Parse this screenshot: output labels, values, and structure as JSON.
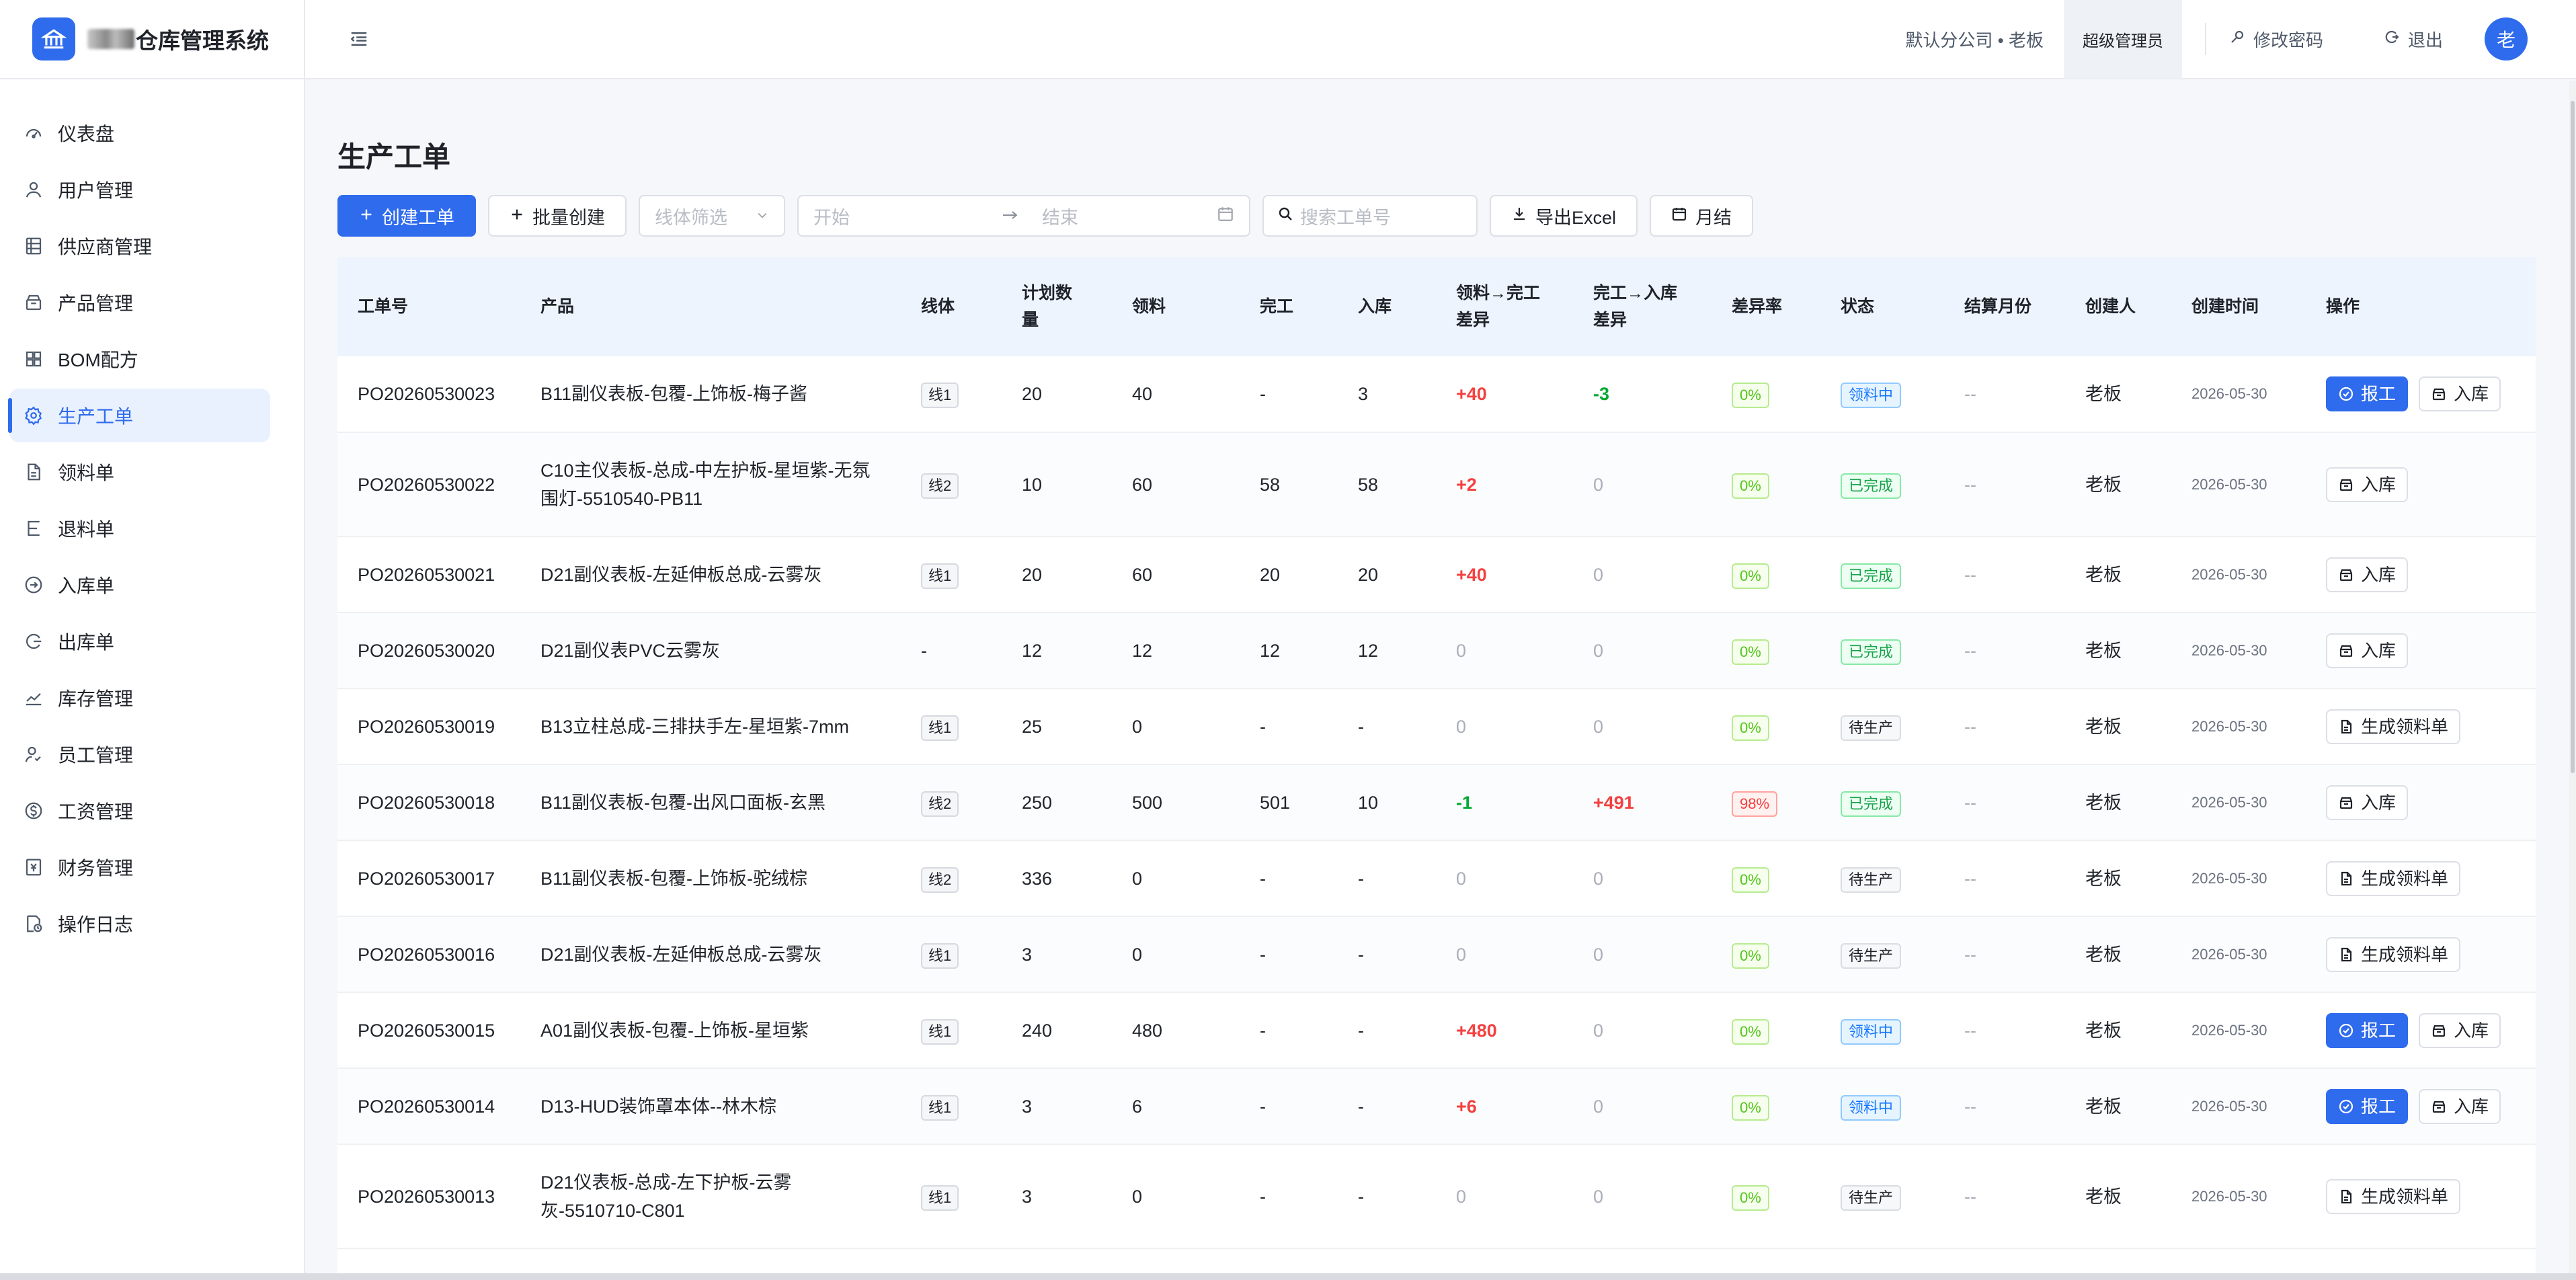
{
  "header": {
    "brand_title": "仓库管理系统",
    "company": "默认分公司 • 老板",
    "role": "超级管理员",
    "change_password": "修改密码",
    "logout": "退出",
    "avatar_text": "老"
  },
  "sidebar": {
    "items": [
      {
        "label": "仪表盘",
        "icon": "dashboard-icon"
      },
      {
        "label": "用户管理",
        "icon": "user-icon"
      },
      {
        "label": "供应商管理",
        "icon": "supplier-icon"
      },
      {
        "label": "产品管理",
        "icon": "product-icon"
      },
      {
        "label": "BOM配方",
        "icon": "grid-icon"
      },
      {
        "label": "生产工单",
        "icon": "gear-icon",
        "active": true
      },
      {
        "label": "领料单",
        "icon": "document-icon"
      },
      {
        "label": "退料单",
        "icon": "return-icon"
      },
      {
        "label": "入库单",
        "icon": "inbound-icon"
      },
      {
        "label": "出库单",
        "icon": "outbound-icon"
      },
      {
        "label": "库存管理",
        "icon": "trend-icon"
      },
      {
        "label": "员工管理",
        "icon": "staff-icon"
      },
      {
        "label": "工资管理",
        "icon": "salary-icon"
      },
      {
        "label": "财务管理",
        "icon": "finance-icon"
      },
      {
        "label": "操作日志",
        "icon": "log-icon"
      }
    ]
  },
  "page": {
    "title": "生产工单"
  },
  "toolbar": {
    "create_label": "创建工单",
    "batch_create_label": "批量创建",
    "line_filter_placeholder": "线体筛选",
    "date_start_placeholder": "开始",
    "date_end_placeholder": "结束",
    "search_placeholder": "搜索工单号",
    "export_label": "导出Excel",
    "monthly_label": "月结"
  },
  "table": {
    "headers": [
      "工单号",
      "产品",
      "线体",
      "计划数量",
      "领料",
      "完工",
      "入库",
      "领料→完工差异",
      "完工→入库差异",
      "差异率",
      "状态",
      "结算月份",
      "创建人",
      "创建时间",
      "操作"
    ],
    "header_lines": {
      "plan_qty": [
        "计划数",
        "量"
      ],
      "diff1": [
        "领料→完工",
        "差异"
      ],
      "diff2": [
        "完工→入库",
        "差异"
      ]
    },
    "action_labels": {
      "report": "报工",
      "stock_in": "入库",
      "gen_pick": "生成领料单"
    },
    "rows": [
      {
        "order_no": "PO20260530023",
        "product": "B11副仪表板-包覆-上饰板-梅子酱",
        "line": "线1",
        "plan": "20",
        "pick": "40",
        "done": "-",
        "stock": "3",
        "diff1": "+40",
        "diff1_color": "red",
        "diff2": "-3",
        "diff2_color": "green",
        "rate": "0%",
        "rate_bad": false,
        "status": "领料中",
        "status_type": "blue",
        "settle": "--",
        "creator": "老板",
        "created": "2026-05-30",
        "actions": [
          "report",
          "stock_in"
        ]
      },
      {
        "order_no": "PO20260530022",
        "product": "C10主仪表板-总成-中左护板-星垣紫-无氛围灯-5510540-PB11",
        "line": "线2",
        "plan": "10",
        "pick": "60",
        "done": "58",
        "stock": "58",
        "diff1": "+2",
        "diff1_color": "red",
        "diff2": "0",
        "diff2_color": "gray",
        "rate": "0%",
        "rate_bad": false,
        "status": "已完成",
        "status_type": "done",
        "settle": "--",
        "creator": "老板",
        "created": "2026-05-30",
        "actions": [
          "stock_in"
        ],
        "tall": true
      },
      {
        "order_no": "PO20260530021",
        "product": "D21副仪表板-左延伸板总成-云雾灰",
        "line": "线1",
        "plan": "20",
        "pick": "60",
        "done": "20",
        "stock": "20",
        "diff1": "+40",
        "diff1_color": "red",
        "diff2": "0",
        "diff2_color": "gray",
        "rate": "0%",
        "rate_bad": false,
        "status": "已完成",
        "status_type": "done",
        "settle": "--",
        "creator": "老板",
        "created": "2026-05-30",
        "actions": [
          "stock_in"
        ]
      },
      {
        "order_no": "PO20260530020",
        "product": "D21副仪表PVC云雾灰",
        "line": "-",
        "plan": "12",
        "pick": "12",
        "done": "12",
        "stock": "12",
        "diff1": "0",
        "diff1_color": "gray",
        "diff2": "0",
        "diff2_color": "gray",
        "rate": "0%",
        "rate_bad": false,
        "status": "已完成",
        "status_type": "done",
        "settle": "--",
        "creator": "老板",
        "created": "2026-05-30",
        "actions": [
          "stock_in"
        ]
      },
      {
        "order_no": "PO20260530019",
        "product": "B13立柱总成-三排扶手左-星垣紫-7mm",
        "line": "线1",
        "plan": "25",
        "pick": "0",
        "done": "-",
        "stock": "-",
        "diff1": "0",
        "diff1_color": "gray",
        "diff2": "0",
        "diff2_color": "gray",
        "rate": "0%",
        "rate_bad": false,
        "status": "待生产",
        "status_type": "wait",
        "settle": "--",
        "creator": "老板",
        "created": "2026-05-30",
        "actions": [
          "gen_pick"
        ]
      },
      {
        "order_no": "PO20260530018",
        "product": "B11副仪表板-包覆-出风口面板-玄黑",
        "line": "线2",
        "plan": "250",
        "pick": "500",
        "done": "501",
        "stock": "10",
        "diff1": "-1",
        "diff1_color": "green",
        "diff2": "+491",
        "diff2_color": "red",
        "rate": "98%",
        "rate_bad": true,
        "status": "已完成",
        "status_type": "done",
        "settle": "--",
        "creator": "老板",
        "created": "2026-05-30",
        "actions": [
          "stock_in"
        ]
      },
      {
        "order_no": "PO20260530017",
        "product": "B11副仪表板-包覆-上饰板-驼绒棕",
        "line": "线2",
        "plan": "336",
        "pick": "0",
        "done": "-",
        "stock": "-",
        "diff1": "0",
        "diff1_color": "gray",
        "diff2": "0",
        "diff2_color": "gray",
        "rate": "0%",
        "rate_bad": false,
        "status": "待生产",
        "status_type": "wait",
        "settle": "--",
        "creator": "老板",
        "created": "2026-05-30",
        "actions": [
          "gen_pick"
        ]
      },
      {
        "order_no": "PO20260530016",
        "product": "D21副仪表板-左延伸板总成-云雾灰",
        "line": "线1",
        "plan": "3",
        "pick": "0",
        "done": "-",
        "stock": "-",
        "diff1": "0",
        "diff1_color": "gray",
        "diff2": "0",
        "diff2_color": "gray",
        "rate": "0%",
        "rate_bad": false,
        "status": "待生产",
        "status_type": "wait",
        "settle": "--",
        "creator": "老板",
        "created": "2026-05-30",
        "actions": [
          "gen_pick"
        ]
      },
      {
        "order_no": "PO20260530015",
        "product": "A01副仪表板-包覆-上饰板-星垣紫",
        "line": "线1",
        "plan": "240",
        "pick": "480",
        "done": "-",
        "stock": "-",
        "diff1": "+480",
        "diff1_color": "red",
        "diff2": "0",
        "diff2_color": "gray",
        "rate": "0%",
        "rate_bad": false,
        "status": "领料中",
        "status_type": "blue",
        "settle": "--",
        "creator": "老板",
        "created": "2026-05-30",
        "actions": [
          "report",
          "stock_in"
        ]
      },
      {
        "order_no": "PO20260530014",
        "product": "D13-HUD装饰罩本体--林木棕",
        "line": "线1",
        "plan": "3",
        "pick": "6",
        "done": "-",
        "stock": "-",
        "diff1": "+6",
        "diff1_color": "red",
        "diff2": "0",
        "diff2_color": "gray",
        "rate": "0%",
        "rate_bad": false,
        "status": "领料中",
        "status_type": "blue",
        "settle": "--",
        "creator": "老板",
        "created": "2026-05-30",
        "actions": [
          "report",
          "stock_in"
        ]
      },
      {
        "order_no": "PO20260530013",
        "product": "D21仪表板-总成-左下护板-云雾灰-5510710-C801",
        "line": "线1",
        "plan": "3",
        "pick": "0",
        "done": "-",
        "stock": "-",
        "diff1": "0",
        "diff1_color": "gray",
        "diff2": "0",
        "diff2_color": "gray",
        "rate": "0%",
        "rate_bad": false,
        "status": "待生产",
        "status_type": "wait",
        "settle": "--",
        "creator": "老板",
        "created": "2026-05-30",
        "actions": [
          "gen_pick"
        ],
        "tall": true
      }
    ]
  }
}
